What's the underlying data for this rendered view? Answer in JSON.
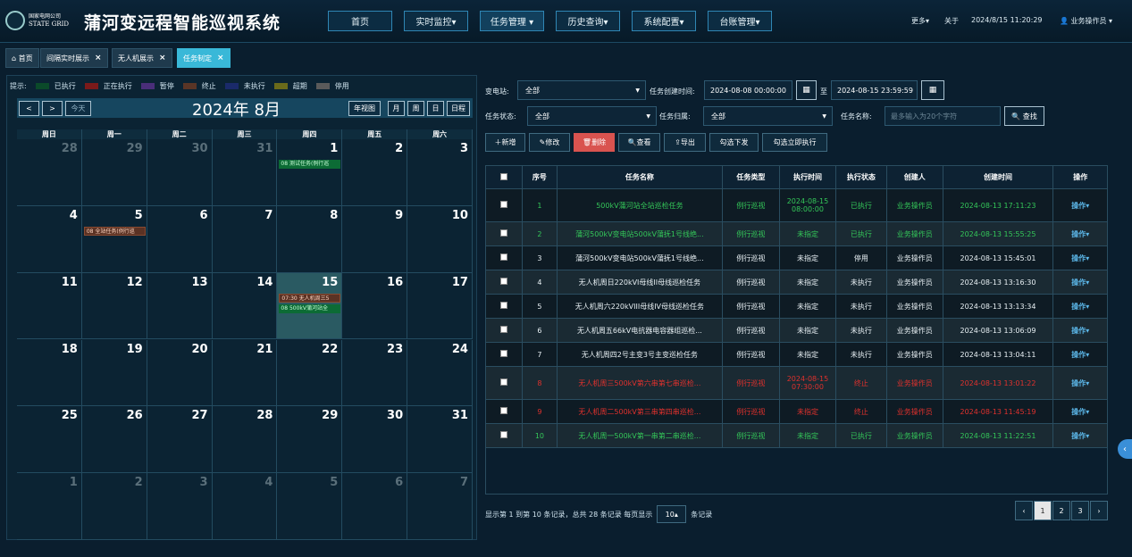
{
  "header": {
    "logo_line1": "国家电网公司",
    "logo_line2": "STATE GRID",
    "app_title": "蒲河变远程智能巡视系统",
    "nav": [
      {
        "label": "首页"
      },
      {
        "label": "实时监控▾"
      },
      {
        "label": "任务管理 ▾"
      },
      {
        "label": "历史查询▾"
      },
      {
        "label": "系统配置▾"
      },
      {
        "label": "台账管理▾"
      }
    ],
    "more": "更多▾",
    "about": "关于",
    "datetime": "2024/8/15 11:20:29",
    "user": "业务操作员 ▾"
  },
  "tabs": [
    {
      "label": "首页"
    },
    {
      "label": "间隔实时展示"
    },
    {
      "label": "无人机展示"
    },
    {
      "label": "任务制定"
    }
  ],
  "legend": {
    "prefix": "提示:",
    "items": [
      {
        "label": "已执行",
        "color": "#0b4a2a"
      },
      {
        "label": "正在执行",
        "color": "#7a1a1a"
      },
      {
        "label": "暂停",
        "color": "#4a2e7a"
      },
      {
        "label": "终止",
        "color": "#5a3526"
      },
      {
        "label": "未执行",
        "color": "#1a2a6a"
      },
      {
        "label": "超期",
        "color": "#6a6a1a"
      },
      {
        "label": "停用",
        "color": "#5a5a5a"
      }
    ]
  },
  "calendar": {
    "prev": "<",
    "next": ">",
    "today": "今天",
    "month_title": "2024年 8月",
    "year_view": "年视图",
    "views": [
      "月",
      "周",
      "日",
      "日程"
    ],
    "weekdays": [
      "周日",
      "周一",
      "周二",
      "周三",
      "周四",
      "周五",
      "周六"
    ],
    "weeks": [
      [
        {
          "d": "28",
          "dim": true
        },
        {
          "d": "29",
          "dim": true
        },
        {
          "d": "30",
          "dim": true
        },
        {
          "d": "31",
          "dim": true
        },
        {
          "d": "1",
          "events": [
            {
              "t": "08 测试任务(例行巡",
              "c": "green"
            }
          ]
        },
        {
          "d": "2"
        },
        {
          "d": "3"
        }
      ],
      [
        {
          "d": "4"
        },
        {
          "d": "5",
          "events": [
            {
              "t": "08 全站任务(例行巡",
              "c": "red"
            }
          ]
        },
        {
          "d": "6"
        },
        {
          "d": "7"
        },
        {
          "d": "8"
        },
        {
          "d": "9"
        },
        {
          "d": "10"
        }
      ],
      [
        {
          "d": "11"
        },
        {
          "d": "12"
        },
        {
          "d": "13"
        },
        {
          "d": "14"
        },
        {
          "d": "15",
          "today": true,
          "events": [
            {
              "t": "07:30 无人机周三5",
              "c": "red"
            },
            {
              "t": "08 500kV蒲河站全",
              "c": "green"
            }
          ]
        },
        {
          "d": "16"
        },
        {
          "d": "17"
        }
      ],
      [
        {
          "d": "18"
        },
        {
          "d": "19"
        },
        {
          "d": "20"
        },
        {
          "d": "21"
        },
        {
          "d": "22"
        },
        {
          "d": "23"
        },
        {
          "d": "24"
        }
      ],
      [
        {
          "d": "25"
        },
        {
          "d": "26"
        },
        {
          "d": "27"
        },
        {
          "d": "28"
        },
        {
          "d": "29"
        },
        {
          "d": "30"
        },
        {
          "d": "31"
        }
      ],
      [
        {
          "d": "1",
          "dim": true
        },
        {
          "d": "2",
          "dim": true
        },
        {
          "d": "3",
          "dim": true
        },
        {
          "d": "4",
          "dim": true
        },
        {
          "d": "5",
          "dim": true
        },
        {
          "d": "6",
          "dim": true
        },
        {
          "d": "7",
          "dim": true
        }
      ]
    ]
  },
  "filters": {
    "substation_label": "变电站:",
    "substation_value": "全部",
    "created_label": "任务创建时间:",
    "created_from": "2024-08-08 00:00:00",
    "to_label": "至",
    "created_to": "2024-08-15 23:59:59",
    "status_label": "任务状态:",
    "status_value": "全部",
    "owner_label": "任务归属:",
    "owner_value": "全部",
    "name_label": "任务名称:",
    "name_placeholder": "最多输入为20个字符",
    "search": "查找"
  },
  "actions": {
    "add": "新增",
    "edit": "修改",
    "delete": "删除",
    "view": "查看",
    "export": "导出",
    "check_dispatch": "勾选下发",
    "check_run": "勾选立即执行"
  },
  "table": {
    "headers": [
      "序号",
      "任务名称",
      "任务类型",
      "执行时间",
      "执行状态",
      "创建人",
      "创建时间",
      "操作"
    ],
    "rows": [
      {
        "n": "1",
        "name": "500kV蒲河站全站巡检任务",
        "type": "例行巡视",
        "time": "2024-08-15\n08:00:00",
        "status": "已执行",
        "creator": "业务操作员",
        "created": "2024-08-13 17:11:23",
        "op": "操作▾",
        "color": "g",
        "tall": true
      },
      {
        "n": "2",
        "name": "蒲河500kV变电站500kV蒲抚1号线绝...",
        "type": "例行巡视",
        "time": "未指定",
        "status": "已执行",
        "creator": "业务操作员",
        "created": "2024-08-13 15:55:25",
        "op": "操作▾",
        "color": "g"
      },
      {
        "n": "3",
        "name": "蒲河500kV变电站500kV蒲抚1号线绝...",
        "type": "例行巡视",
        "time": "未指定",
        "status": "停用",
        "creator": "业务操作员",
        "created": "2024-08-13 15:45:01",
        "op": "操作▾",
        "color": "w"
      },
      {
        "n": "4",
        "name": "无人机周日220kVI母线II母线巡检任务",
        "type": "例行巡视",
        "time": "未指定",
        "status": "未执行",
        "creator": "业务操作员",
        "created": "2024-08-13 13:16:30",
        "op": "操作▾",
        "color": "w"
      },
      {
        "n": "5",
        "name": "无人机周六220kVIII母线IV母线巡检任务",
        "type": "例行巡视",
        "time": "未指定",
        "status": "未执行",
        "creator": "业务操作员",
        "created": "2024-08-13 13:13:34",
        "op": "操作▾",
        "color": "w"
      },
      {
        "n": "6",
        "name": "无人机周五66kV电抗器电容器组巡检...",
        "type": "例行巡视",
        "time": "未指定",
        "status": "未执行",
        "creator": "业务操作员",
        "created": "2024-08-13 13:06:09",
        "op": "操作▾",
        "color": "w"
      },
      {
        "n": "7",
        "name": "无人机周四2号主变3号主变巡检任务",
        "type": "例行巡视",
        "time": "未指定",
        "status": "未执行",
        "creator": "业务操作员",
        "created": "2024-08-13 13:04:11",
        "op": "操作▾",
        "color": "w"
      },
      {
        "n": "8",
        "name": "无人机周三500kV第六串第七串巡检...",
        "type": "例行巡视",
        "time": "2024-08-15\n07:30:00",
        "status": "终止",
        "creator": "业务操作员",
        "created": "2024-08-13 13:01:22",
        "op": "操作▾",
        "color": "rd",
        "tall": true
      },
      {
        "n": "9",
        "name": "无人机周二500kV第三串第四串巡检...",
        "type": "例行巡视",
        "time": "未指定",
        "status": "终止",
        "creator": "业务操作员",
        "created": "2024-08-13 11:45:19",
        "op": "操作▾",
        "color": "rd"
      },
      {
        "n": "10",
        "name": "无人机周一500kV第一串第二串巡检...",
        "type": "例行巡视",
        "time": "未指定",
        "status": "已执行",
        "creator": "业务操作员",
        "created": "2024-08-13 11:22:51",
        "op": "操作▾",
        "color": "g"
      }
    ]
  },
  "footer": {
    "summary": "显示第 1 到第 10 条记录，总共 28 条记录  每页显示",
    "page_size": "10▴",
    "suffix": "条记录",
    "pages": [
      "‹",
      "1",
      "2",
      "3",
      "›"
    ],
    "current_page": "1"
  }
}
